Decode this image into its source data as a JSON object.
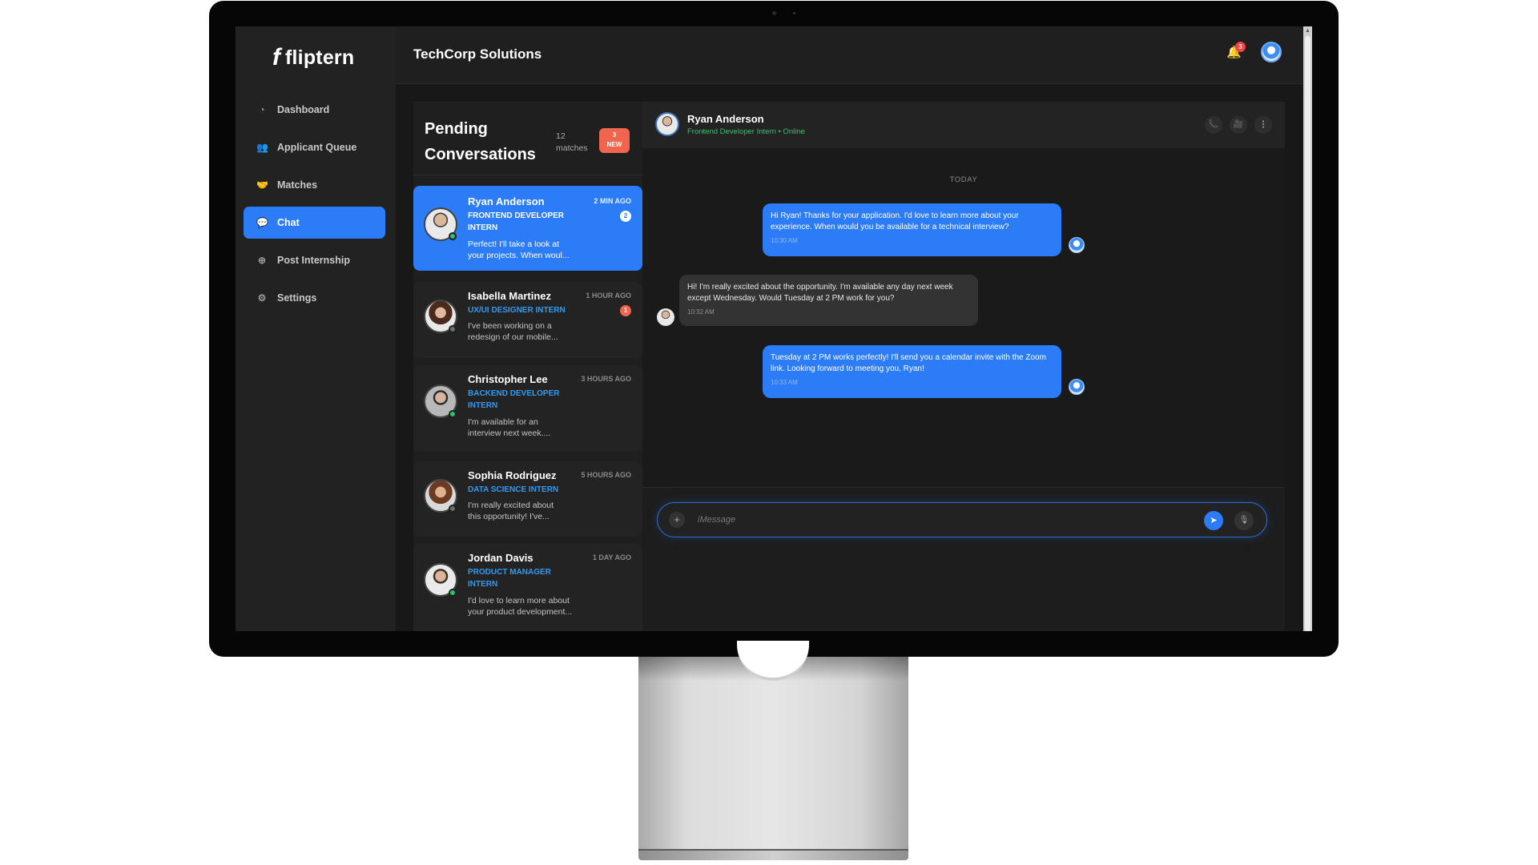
{
  "app": {
    "logo_mark": "f",
    "logo_text": "fliptern",
    "company": "TechCorp Solutions",
    "notification_count": "3"
  },
  "sidebar": {
    "items": [
      {
        "label": "Dashboard",
        "icon": "dashboard-icon",
        "glyph": "◔"
      },
      {
        "label": "Applicant Queue",
        "icon": "users-icon",
        "glyph": "👥"
      },
      {
        "label": "Matches",
        "icon": "handshake-icon",
        "glyph": "🤝"
      },
      {
        "label": "Chat",
        "icon": "chat-icon",
        "glyph": "💬"
      },
      {
        "label": "Post Internship",
        "icon": "plus-circle-icon",
        "glyph": "⊕"
      },
      {
        "label": "Settings",
        "icon": "gear-icon",
        "glyph": "⚙"
      }
    ],
    "active": "Chat"
  },
  "conversations": {
    "title": "Pending Conversations",
    "count_number": "12",
    "count_label": "matches",
    "new_number": "3",
    "new_label": "NEW",
    "items": [
      {
        "name": "Ryan Anderson",
        "role_line1": "FRONTEND DEVELOPER",
        "role_line2": "INTERN",
        "time": "2 MIN AGO",
        "preview_line1": "Perfect! I'll take a look at",
        "preview_line2": "your projects. When woul...",
        "unread": "2",
        "online": true
      },
      {
        "name": "Isabella Martinez",
        "role_line1": "UX/UI DESIGNER INTERN",
        "role_line2": "",
        "time": "1 HOUR AGO",
        "preview_line1": "I've been working on a",
        "preview_line2": "redesign of our mobile...",
        "unread": "1",
        "online": false
      },
      {
        "name": "Christopher Lee",
        "role_line1": "BACKEND DEVELOPER",
        "role_line2": "INTERN",
        "time": "3 HOURS AGO",
        "preview_line1": "I'm available for an",
        "preview_line2": "interview next week....",
        "unread": "",
        "online": true
      },
      {
        "name": "Sophia Rodriguez",
        "role_line1": "DATA SCIENCE INTERN",
        "role_line2": "",
        "time": "5 HOURS AGO",
        "preview_line1": "I'm really excited about",
        "preview_line2": "this opportunity! I've...",
        "unread": "",
        "online": false
      },
      {
        "name": "Jordan Davis",
        "role_line1": "PRODUCT MANAGER",
        "role_line2": "INTERN",
        "time": "1 DAY AGO",
        "preview_line1": "I'd love to learn more about",
        "preview_line2": "your product development...",
        "unread": "",
        "online": true
      }
    ]
  },
  "chat": {
    "name": "Ryan Anderson",
    "status": "Frontend Developer Intern • Online",
    "date_divider": "TODAY",
    "messages": [
      {
        "from": "me",
        "text": "Hi Ryan! Thanks for your application. I'd love to learn more about your experience. When would you be available for a technical interview?",
        "time": "10:30 AM"
      },
      {
        "from": "them",
        "text": "Hi! I'm really excited about the opportunity. I'm available any day next week except Wednesday. Would Tuesday at 2 PM work for you?",
        "time": "10:32 AM"
      },
      {
        "from": "me",
        "text": "Tuesday at 2 PM works perfectly! I'll send you a calendar invite with the Zoom link. Looking forward to meeting you, Ryan!",
        "time": "10:33 AM"
      }
    ],
    "composer_placeholder": "iMessage"
  },
  "colors": {
    "accent": "#2b7cf6",
    "badge_red": "#f0654d",
    "online_green": "#31c26b",
    "role_blue": "#2f9bf3"
  }
}
